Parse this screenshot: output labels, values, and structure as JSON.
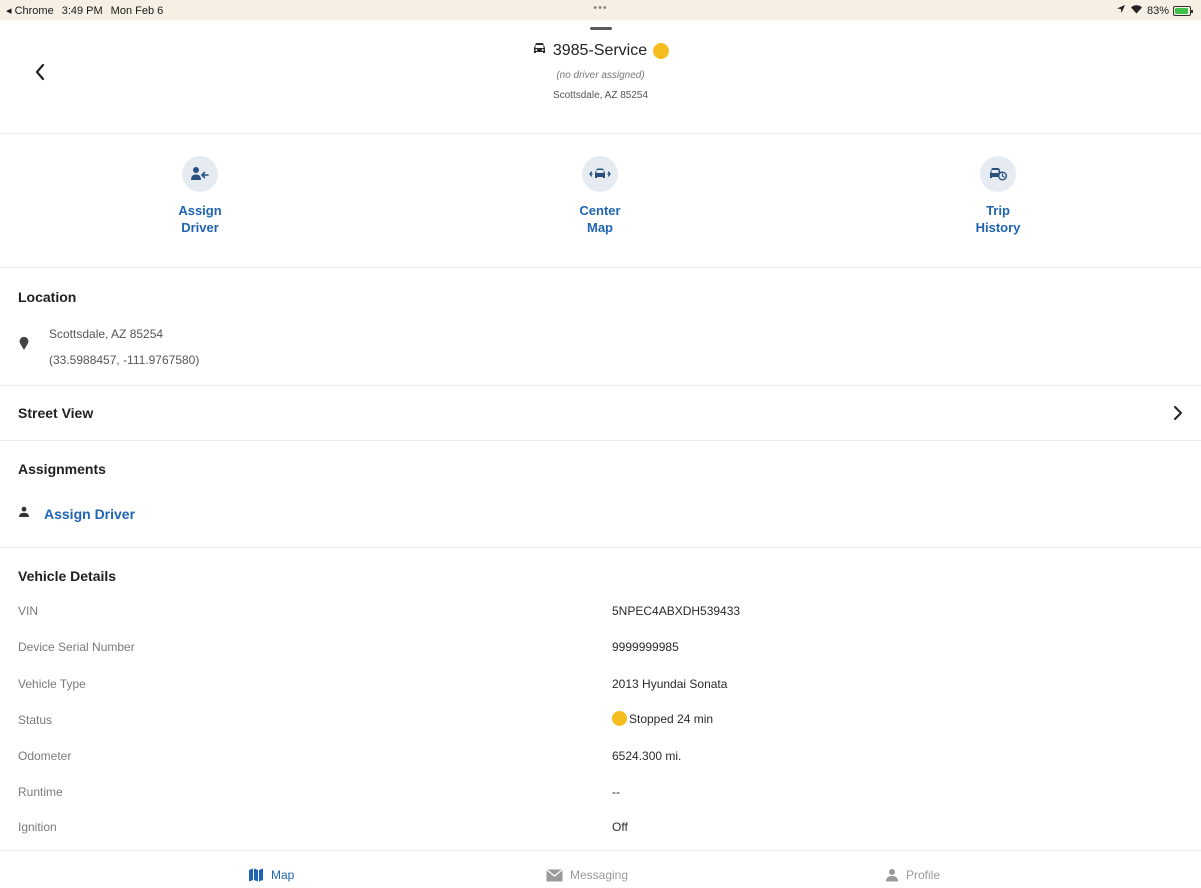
{
  "status_bar": {
    "back_app": "◂ Chrome",
    "time": "3:49 PM",
    "date": "Mon Feb 6",
    "dots": "•••",
    "battery": "83%"
  },
  "header": {
    "title": "3985-Service",
    "subtitle": "(no driver assigned)",
    "location": "Scottsdale, AZ 85254",
    "status_color": "#f5bd1f"
  },
  "actions": {
    "assign_driver": {
      "line1": "Assign",
      "line2": "Driver",
      "icon": "assign-driver-icon"
    },
    "center_map": {
      "line1": "Center",
      "line2": "Map",
      "icon": "center-map-icon"
    },
    "trip_history": {
      "line1": "Trip",
      "line2": "History",
      "icon": "trip-history-icon"
    }
  },
  "location": {
    "title": "Location",
    "address": "Scottsdale, AZ 85254",
    "coords": "(33.5988457, -111.9767580)"
  },
  "street_view": {
    "title": "Street View"
  },
  "assignments": {
    "title": "Assignments",
    "assign_label": "Assign Driver"
  },
  "vehicle_details": {
    "title": "Vehicle Details",
    "rows": [
      {
        "label": "VIN",
        "value": "5NPEC4ABXDH539433"
      },
      {
        "label": "Device Serial Number",
        "value": "9999999985"
      },
      {
        "label": "Vehicle Type",
        "value": "2013 Hyundai Sonata"
      },
      {
        "label": "Status",
        "value": "Stopped 24 min"
      },
      {
        "label": "Odometer",
        "value": "6524.300 mi."
      },
      {
        "label": "Runtime",
        "value": "--"
      },
      {
        "label": "Ignition",
        "value": "Off"
      }
    ]
  },
  "tabs": {
    "map": "Map",
    "messaging": "Messaging",
    "profile": "Profile"
  },
  "colors": {
    "accent": "#1f64b3",
    "status_yellow": "#f5bd1f",
    "icon_bg": "#e6ebf2"
  }
}
